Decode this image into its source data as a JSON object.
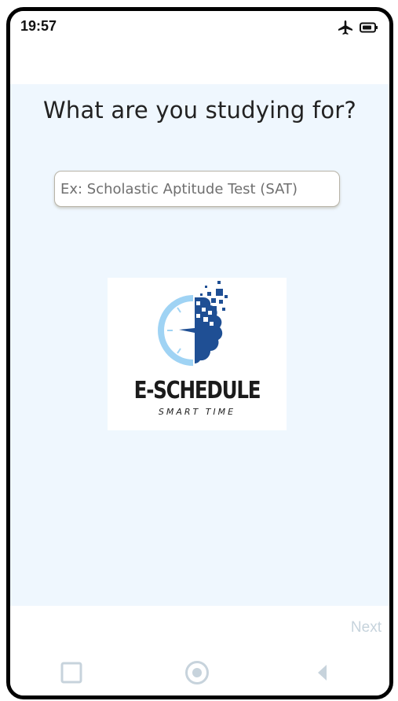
{
  "status_bar": {
    "time": "19:57",
    "icons": [
      "airplane-mode-icon",
      "battery-icon"
    ]
  },
  "main": {
    "heading": "What are you studying for?",
    "study_input": {
      "value": "",
      "placeholder": "Ex: Scholastic Aptitude Test (SAT)"
    },
    "logo": {
      "name": "E-SCHEDULE",
      "tagline": "SMART TIME",
      "colors": {
        "clock": "#9fd3f4",
        "brain": "#1f4f94",
        "text": "#1b1b1b"
      }
    }
  },
  "footer": {
    "next_label": "Next"
  },
  "nav_bar": {
    "buttons": [
      "recents-square-icon",
      "home-circle-icon",
      "back-triangle-icon"
    ]
  },
  "colors": {
    "background": "#eff7fe",
    "frame": "#000000",
    "next_disabled": "#c6d3dc",
    "nav_icon": "#c7d3dc"
  }
}
